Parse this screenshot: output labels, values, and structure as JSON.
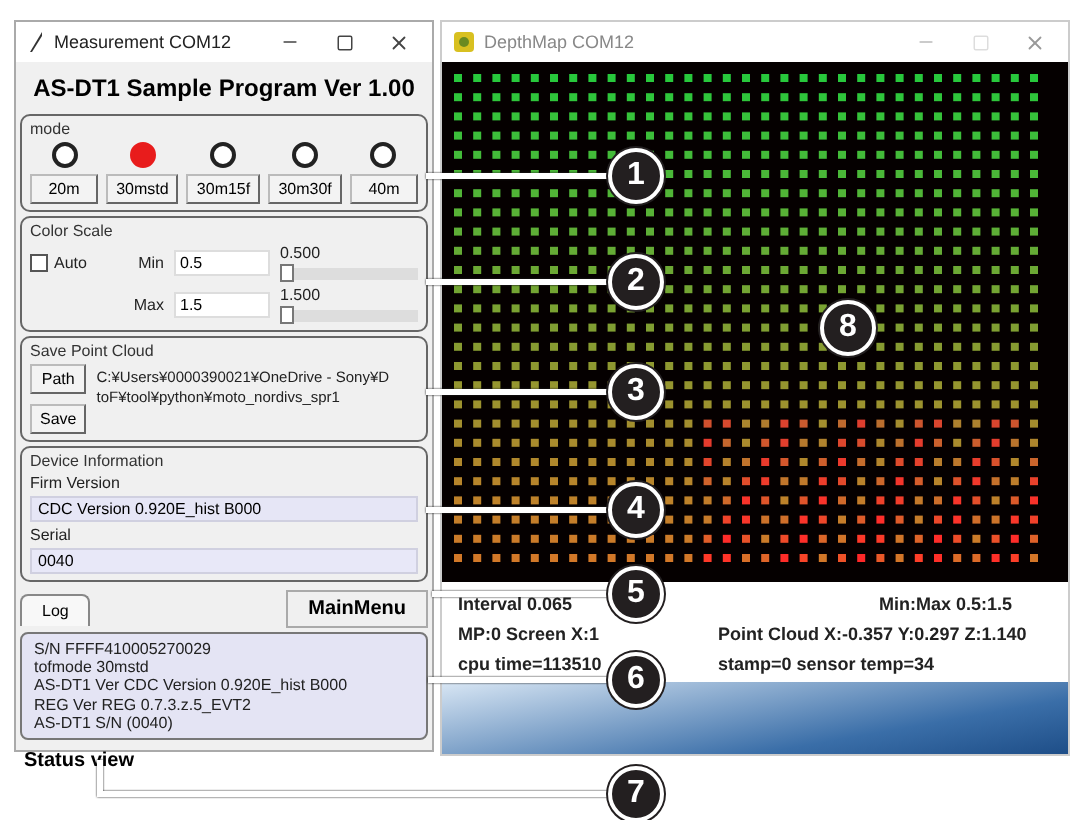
{
  "control_window": {
    "title": "Measurement COM12",
    "heading": "AS-DT1 Sample Program Ver 1.00",
    "mode": {
      "label": "mode",
      "options": [
        {
          "label": "20m",
          "selected": false
        },
        {
          "label": "30mstd",
          "selected": true
        },
        {
          "label": "30m15f",
          "selected": false
        },
        {
          "label": "30m30f",
          "selected": false
        },
        {
          "label": "40m",
          "selected": false
        }
      ]
    },
    "color_scale": {
      "label": "Color Scale",
      "auto": {
        "label": "Auto",
        "checked": false
      },
      "sliders": [
        {
          "label": "Min",
          "value": "0.5",
          "reading": "0.500",
          "level": 0
        },
        {
          "label": "Max",
          "value": "1.5",
          "reading": "1.500",
          "level": 0
        }
      ]
    },
    "save_point_cloud": {
      "label": "Save Point Cloud",
      "path_button": "Path",
      "save_button": "Save",
      "path_lines": [
        "C:¥Users¥0000390021¥OneDrive - Sony¥D",
        "toF¥tool¥python¥moto_nordivs_spr1"
      ]
    },
    "device_info": {
      "label": "Device Information",
      "fields": [
        {
          "label": "Firm Version",
          "value": "CDC Version 0.920E_hist B000"
        },
        {
          "label": "Serial",
          "value": "0040"
        }
      ]
    },
    "tabs": [
      {
        "label": "Log",
        "selected": true
      },
      {
        "label": "MainMenu",
        "selected": false
      }
    ],
    "log_lines": [
      "S/N FFFF410005270029",
      "tofmode 30mstd",
      "AS-DT1 Ver CDC Version 0.920E_hist B000",
      "REG Ver REG 0.7.3.z.5_EVT2",
      "AS-DT1 S/N (0040)"
    ],
    "status": "Status view"
  },
  "depth_window": {
    "title": "DepthMap COM12",
    "info_rows": [
      [
        "Interval 0.065",
        "Min:Max 0.5:1.5"
      ],
      [
        "MP:0 Screen X:1",
        "Point Cloud X:-0.357 Y:0.297 Z:1.140"
      ],
      [
        "cpu time=113510",
        "stamp=0  sensor temp=34"
      ]
    ]
  },
  "callouts": [
    {
      "number": "1"
    },
    {
      "number": "2"
    },
    {
      "number": "3"
    },
    {
      "number": "4"
    },
    {
      "number": "5"
    },
    {
      "number": "6"
    },
    {
      "number": "7"
    },
    {
      "number": "8"
    }
  ]
}
